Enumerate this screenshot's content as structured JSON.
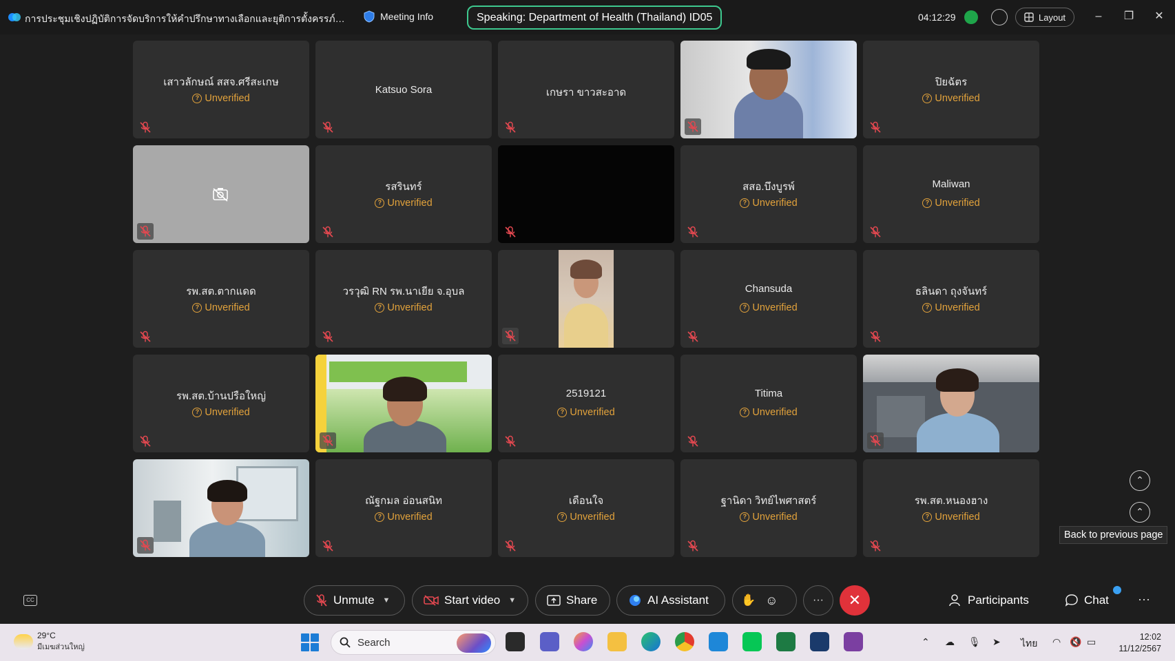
{
  "titlebar": {
    "meeting_title": "การประชุมเชิงปฏิบัติการจัดบริการให้คำปรึกษาทางเลือกและยุติการตั้งครรภ์ที่ปลอด...",
    "meeting_info": "Meeting Info",
    "speaking": "Speaking: Department of Health (Thailand) ID05",
    "timer": "04:12:29",
    "layout": "Layout"
  },
  "unverified_label": "Unverified",
  "tiles": [
    {
      "name": "เสาวลักษณ์ สสจ.ศรีสะเกษ",
      "unverified": true
    },
    {
      "name": "Katsuo Sora",
      "unverified": false
    },
    {
      "name": "เกษรา ขาวสะอาด",
      "unverified": false
    },
    {
      "video": "woman-office"
    },
    {
      "name": "ปิยฉัตร",
      "unverified": true
    },
    {
      "camera_off": true
    },
    {
      "name": "รสรินทร์",
      "unverified": true
    },
    {
      "black": true
    },
    {
      "name": "สสอ.บึงบูรพ์",
      "unverified": true
    },
    {
      "name": "Maliwan",
      "unverified": true
    },
    {
      "name": "รพ.สต.ตากแดด",
      "unverified": true
    },
    {
      "name": "วรวุฒิ RN รพ.นาเยีย จ.อุบล",
      "unverified": true
    },
    {
      "video": "portrait"
    },
    {
      "name": "Chansuda",
      "unverified": true
    },
    {
      "name": "ธลินดา ถุงจันทร์",
      "unverified": true
    },
    {
      "name": "รพ.สต.บ้านปรือใหญ่",
      "unverified": true
    },
    {
      "video": "smiling-woman"
    },
    {
      "name": "2519121",
      "unverified": true
    },
    {
      "name": "Titima",
      "unverified": true
    },
    {
      "video": "woman-file-cabinet"
    },
    {
      "video": "woman-room"
    },
    {
      "name": "ณัฐกมล  อ่อนสนิท",
      "unverified": true
    },
    {
      "name": "เดือนใจ",
      "unverified": true
    },
    {
      "name": "ฐานิดา วิทย์ไพศาสตร์",
      "unverified": true
    },
    {
      "name": "รพ.สต.หนองฮาง",
      "unverified": true
    }
  ],
  "tooltip": "Back to previous page",
  "controls": {
    "unmute": "Unmute",
    "start_video": "Start video",
    "share": "Share",
    "ai_assistant": "AI Assistant",
    "participants": "Participants",
    "chat": "Chat"
  },
  "taskbar": {
    "temperature": "29°C",
    "weather_desc": "มีเมฆส่วนใหญ่",
    "search": "Search",
    "language": "ไทย",
    "time": "12:02",
    "date": "11/12/2567"
  },
  "colors": {
    "speaking_border": "#3ec98f",
    "unverified": "#e2a23b",
    "end_call": "#e0323a",
    "chat_badge": "#3aa0f2"
  }
}
